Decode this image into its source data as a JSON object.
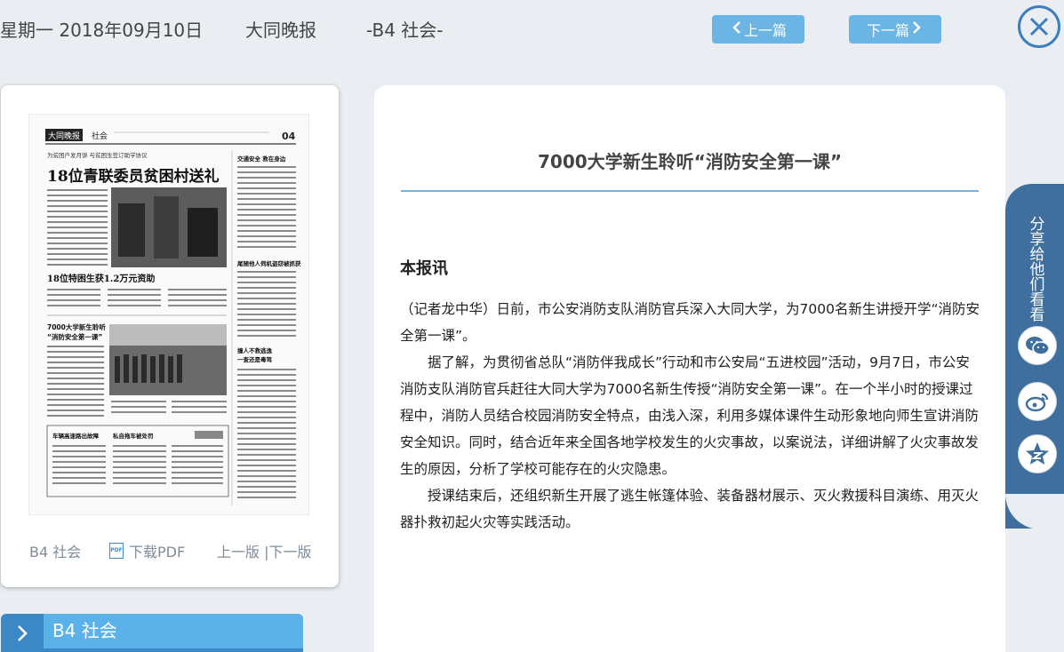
{
  "header": {
    "date": "星期一 2018年09月10日",
    "newspaper": "大同晚报",
    "section": "-B4 社会-",
    "prev_label": "上一篇",
    "next_label": "下一篇"
  },
  "page_card": {
    "edition_label": "B4 社会",
    "download_label": "下载PDF",
    "page_nav_label": "上一版 |下一版",
    "thumbnail": {
      "masthead": "大同晚报",
      "section": "社会",
      "page_no": "04",
      "kicker": "为贫困户发月饼 与贫困生签订助学协议",
      "headline1": "18位青联委员贫困村送礼",
      "headline2": "18位特困生获1.2万元资助",
      "headline3a": "7000大学新生聆听",
      "headline3b": "“消防安全第一课”",
      "side_head1": "交通安全 救在身边",
      "side_head2": "尾随他人伺机盗窃被抓获",
      "side_head3a": "撞人不救逃逸",
      "side_head3b": "一查还是毒驾",
      "bottom_head1": "车辆高速路出故障",
      "bottom_head2": "私自拖车被处罚"
    }
  },
  "section_tab": {
    "label": "B4 社会"
  },
  "article": {
    "title": "7000大学新生聆听“消防安全第一课”",
    "byline": "本报讯",
    "paragraphs": [
      "（记者龙中华）日前，市公安消防支队消防官兵深入大同大学，为7000名新生讲授开学“消防安全第一课”。",
      "据了解，为贯彻省总队“消防伴我成长”行动和市公安局“五进校园”活动，9月7日，市公安消防支队消防官兵赶往大同大学为7000名新生传授“消防安全第一课”。在一个半小时的授课过程中，消防人员结合校园消防安全特点，由浅入深，利用多媒体课件生动形象地向师生宣讲消防安全知识。同时，结合近年来全国各地学校发生的火灾事故，以案说法，详细讲解了火灾事故发生的原因，分析了学校可能存在的火灾隐患。",
      "授课结束后，还组织新生开展了逃生帐篷体验、装备器材展示、灭火救援科目演练、用灭火器扑救初起火灾等实践活动。"
    ]
  },
  "share": {
    "label": "分享给他们看看"
  },
  "colors": {
    "accent": "#6ab5e4",
    "dark_blue": "#3c88c7",
    "share_bg": "#3f6f9e"
  },
  "icons": [
    "chevron-left-icon",
    "chevron-right-icon",
    "close-icon",
    "pdf-icon",
    "wechat-icon",
    "weibo-icon",
    "qzone-icon"
  ]
}
